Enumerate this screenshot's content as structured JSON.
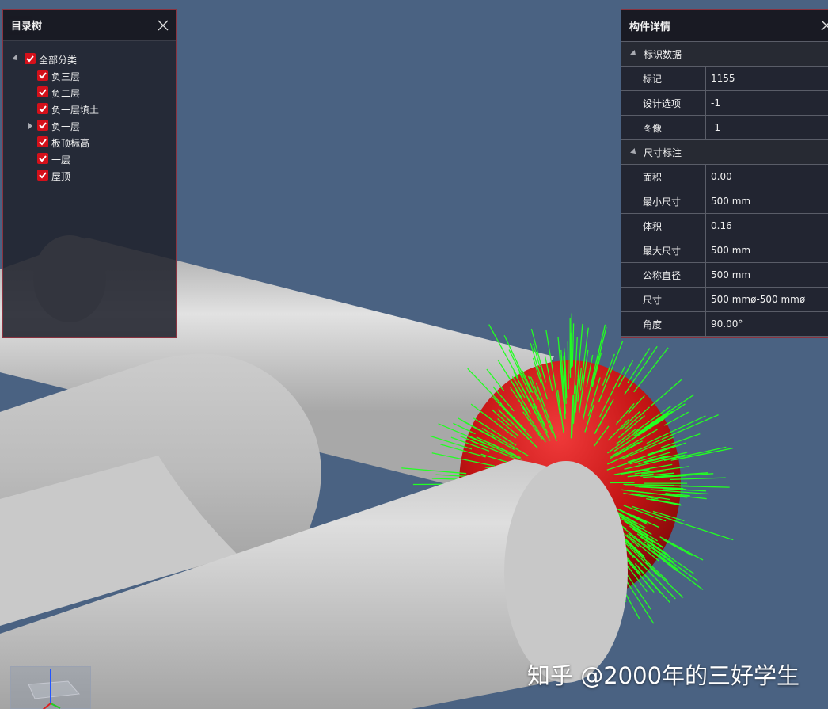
{
  "tree": {
    "title": "目录树",
    "items": [
      {
        "label": "全部分类",
        "level": 0,
        "expander": "expanded",
        "checked": true
      },
      {
        "label": "负三层",
        "level": 1,
        "expander": "none",
        "checked": true
      },
      {
        "label": "负二层",
        "level": 1,
        "expander": "none",
        "checked": true
      },
      {
        "label": "负一层填土",
        "level": 1,
        "expander": "none",
        "checked": true
      },
      {
        "label": "负一层",
        "level": 1,
        "expander": "collapsed",
        "checked": true
      },
      {
        "label": "板顶标高",
        "level": 1,
        "expander": "none",
        "checked": true
      },
      {
        "label": "一层",
        "level": 1,
        "expander": "none",
        "checked": true
      },
      {
        "label": "屋顶",
        "level": 1,
        "expander": "none",
        "checked": true
      }
    ]
  },
  "detail": {
    "title": "构件详情",
    "sections": [
      {
        "label": "标识数据",
        "rows": [
          {
            "key": "标记",
            "value": "1155"
          },
          {
            "key": "设计选项",
            "value": "-1"
          },
          {
            "key": "图像",
            "value": "-1"
          }
        ]
      },
      {
        "label": "尺寸标注",
        "rows": [
          {
            "key": "面积",
            "value": "0.00"
          },
          {
            "key": "最小尺寸",
            "value": "500 mm"
          },
          {
            "key": "体积",
            "value": "0.16"
          },
          {
            "key": "最大尺寸",
            "value": "500 mm"
          },
          {
            "key": "公称直径",
            "value": "500 mm"
          },
          {
            "key": "尺寸",
            "value": "500 mmø-500 mmø"
          },
          {
            "key": "角度",
            "value": "90.00°"
          }
        ]
      }
    ]
  },
  "watermark": {
    "text": "知乎 @2000年的三好学生"
  },
  "colors": {
    "scene_background": "#4a6282",
    "pipe": "#d2d2d2",
    "selected_pipe": "#c01818",
    "normals": "#22ff22",
    "checkbox": "#d4101a",
    "panel_border": "#8a3340"
  }
}
